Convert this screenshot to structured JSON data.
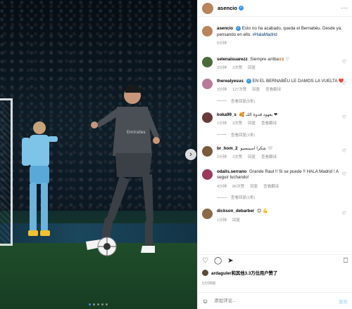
{
  "post": {
    "username": "asencio",
    "more": "···",
    "caption": "Esto no ha acabado, queda el Bernabéu. Desde ya, pensando en ello.",
    "hashtag": "#HalaMadrid",
    "caption_time": "5分钟"
  },
  "comments": [
    {
      "user": "selenaisuarezz",
      "text": "Siempre arriba🙌🏼 ♡",
      "time": "3分钟",
      "likes": "2次赞",
      "reply": "回复",
      "avatar_color": "#4a6a3a"
    },
    {
      "user": "therealyesus",
      "text": "EN EL BERNABÉU LE DAMOS LA VUELTA ❤️",
      "time": "3分钟",
      "likes": "127次赞",
      "reply": "回复",
      "translate": "查看翻译",
      "avatar_color": "#b87a9a",
      "replies_label": "查看回复(5条)"
    },
    {
      "user": "koka99_s",
      "text": "🥰 يعهود قدوة الك ❤",
      "time": "1分钟",
      "likes": "3次赞",
      "reply": "回复",
      "translate": "查看翻译",
      "avatar_color": "#6a3a3a",
      "replies_label": "查看回复(1条)"
    },
    {
      "user": "br_hom_2",
      "text": "شكرا اسينسيو 🤍",
      "time": "2分钟",
      "likes": "2次赞",
      "reply": "回复",
      "translate": "查看翻译",
      "avatar_color": "#7a5a3a"
    },
    {
      "user": "odalis.serrano",
      "text": "Grande Raul !! Si se puede !! HALA Madrid ! A seguir luchando!",
      "time": "4分钟",
      "likes": "80次赞",
      "reply": "回复",
      "translate": "查看翻译",
      "avatar_color": "#9a3a5a",
      "replies_label": "查看回复(1条)"
    },
    {
      "user": "dickson_debarber",
      "text": "😊 💪",
      "time": "1分钟",
      "likes": "",
      "reply": "回复",
      "avatar_color": "#8a6a4a"
    }
  ],
  "likes": {
    "text": "ardaguler和其他3.3万位用户赞了",
    "user": "ardaguler"
  },
  "posted_time": "5分钟前",
  "composer": {
    "placeholder": "添加评论...",
    "post_label": "发布"
  },
  "colors": {
    "verified": "#3897f0",
    "link": "#00376b",
    "meta": "#8e8e8e",
    "carousel_active": "#2f8cff"
  }
}
